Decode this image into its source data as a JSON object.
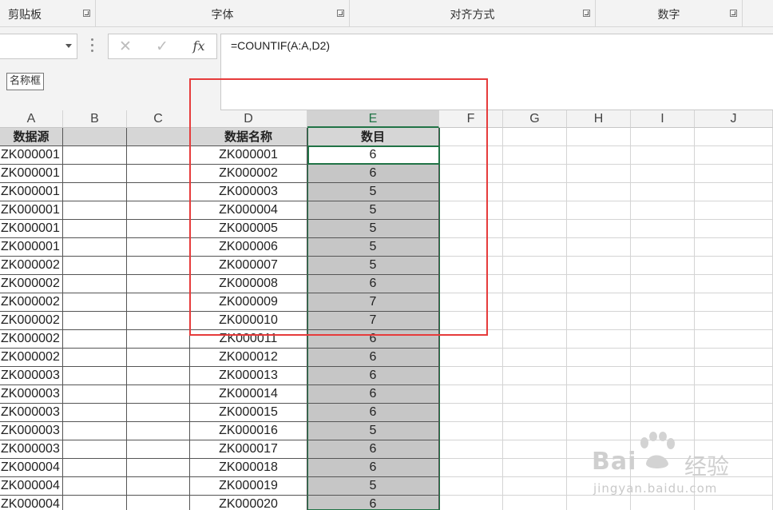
{
  "ribbon": {
    "groups": [
      {
        "label": "剪贴板"
      },
      {
        "label": "字体"
      },
      {
        "label": "对齐方式"
      },
      {
        "label": "数字"
      }
    ]
  },
  "formula_bar": {
    "name_box_value": "",
    "name_box_tooltip": "名称框",
    "cancel_glyph": "✕",
    "enter_glyph": "✓",
    "fx_label": "fx",
    "formula": "=COUNTIF(A:A,D2)"
  },
  "columns": [
    "A",
    "B",
    "C",
    "D",
    "E",
    "F",
    "G",
    "H",
    "I",
    "J"
  ],
  "selected_column": "E",
  "header_row": {
    "A": "数据源",
    "D": "数据名称",
    "E": "数目"
  },
  "rows": [
    {
      "A": "ZK000001",
      "D": "ZK000001",
      "E": "6"
    },
    {
      "A": "ZK000001",
      "D": "ZK000002",
      "E": "6"
    },
    {
      "A": "ZK000001",
      "D": "ZK000003",
      "E": "5"
    },
    {
      "A": "ZK000001",
      "D": "ZK000004",
      "E": "5"
    },
    {
      "A": "ZK000001",
      "D": "ZK000005",
      "E": "5"
    },
    {
      "A": "ZK000001",
      "D": "ZK000006",
      "E": "5"
    },
    {
      "A": "ZK000002",
      "D": "ZK000007",
      "E": "5"
    },
    {
      "A": "ZK000002",
      "D": "ZK000008",
      "E": "6"
    },
    {
      "A": "ZK000002",
      "D": "ZK000009",
      "E": "7"
    },
    {
      "A": "ZK000002",
      "D": "ZK000010",
      "E": "7"
    },
    {
      "A": "ZK000002",
      "D": "ZK000011",
      "E": "6"
    },
    {
      "A": "ZK000002",
      "D": "ZK000012",
      "E": "6"
    },
    {
      "A": "ZK000003",
      "D": "ZK000013",
      "E": "6"
    },
    {
      "A": "ZK000003",
      "D": "ZK000014",
      "E": "6"
    },
    {
      "A": "ZK000003",
      "D": "ZK000015",
      "E": "6"
    },
    {
      "A": "ZK000003",
      "D": "ZK000016",
      "E": "5"
    },
    {
      "A": "ZK000003",
      "D": "ZK000017",
      "E": "6"
    },
    {
      "A": "ZK000004",
      "D": "ZK000018",
      "E": "6"
    },
    {
      "A": "ZK000004",
      "D": "ZK000019",
      "E": "5"
    },
    {
      "A": "ZK000004",
      "D": "ZK000020",
      "E": "6"
    }
  ],
  "watermark": {
    "brand": "Bai",
    "brand_suffix": "经验",
    "url": "jingyan.baidu.com"
  },
  "colors": {
    "accent_green": "#217346",
    "highlight_red": "#e63b3b",
    "selected_fill": "#c6c6c6",
    "header_fill": "#d6d6d6"
  }
}
